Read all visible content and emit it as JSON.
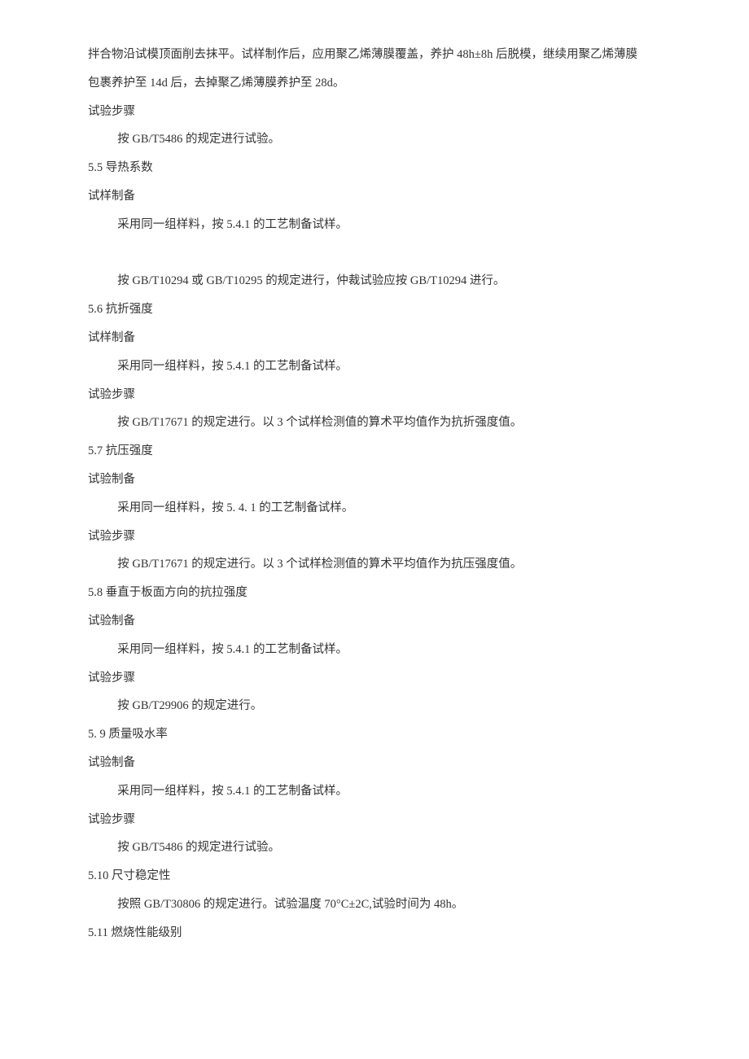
{
  "lines": [
    {
      "text": "拌合物沿试模顶面削去抹平。试样制作后，应用聚乙烯薄膜覆盖，养护 48h±8h 后脱模，继续用聚乙烯薄膜",
      "indent": false
    },
    {
      "text": "包裹养护至 14d 后，去掉聚乙烯薄膜养护至 28d。",
      "indent": false
    },
    {
      "text": "试验步骤",
      "indent": false
    },
    {
      "text": "按 GB/T5486 的规定进行试验。",
      "indent": true
    },
    {
      "text": "5.5   导热系数",
      "indent": false
    },
    {
      "text": "试样制备",
      "indent": false
    },
    {
      "text": "采用同一组样料，按 5.4.1 的工艺制备试样。",
      "indent": true
    },
    {
      "text": " ",
      "indent": false
    },
    {
      "text": "按 GB/T10294 或 GB/T10295 的规定进行，仲裁试验应按 GB/T10294 进行。",
      "indent": true
    },
    {
      "text": "5.6   抗折强度",
      "indent": false
    },
    {
      "text": "试样制备",
      "indent": false
    },
    {
      "text": "采用同一组样料，按 5.4.1 的工艺制备试样。",
      "indent": true
    },
    {
      "text": "试验步骤",
      "indent": false
    },
    {
      "text": "按 GB/T17671 的规定进行。以 3 个试样检测值的算术平均值作为抗折强度值。",
      "indent": true
    },
    {
      "text": "5.7 抗压强度",
      "indent": false
    },
    {
      "text": "试验制备",
      "indent": false
    },
    {
      "text": "采用同一组样料，按 5. 4. 1 的工艺制备试样。",
      "indent": true
    },
    {
      "text": "试验步骤",
      "indent": false
    },
    {
      "text": "按 GB/T17671 的规定进行。以 3 个试样检测值的算术平均值作为抗压强度值。",
      "indent": true
    },
    {
      "text": "5.8 垂直于板面方向的抗拉强度",
      "indent": false
    },
    {
      "text": "试验制备",
      "indent": false
    },
    {
      "text": "采用同一组样料，按 5.4.1 的工艺制备试样。",
      "indent": true
    },
    {
      "text": "试验步骤",
      "indent": false
    },
    {
      "text": "按 GB/T29906 的规定进行。",
      "indent": true
    },
    {
      "text": "5.  9 质量吸水率",
      "indent": false
    },
    {
      "text": "试验制备",
      "indent": false
    },
    {
      "text": "采用同一组样料，按 5.4.1 的工艺制备试样。",
      "indent": true
    },
    {
      "text": "试验步骤",
      "indent": false
    },
    {
      "text": "按 GB/T5486 的规定进行试验。",
      "indent": true
    },
    {
      "text": "5.10   尺寸稳定性",
      "indent": false
    },
    {
      "text": "按照 GB/T30806 的规定进行。试验温度 70°C±2C,试验时间为 48h。",
      "indent": true
    },
    {
      "text": "5.11  燃烧性能级别",
      "indent": false
    }
  ]
}
